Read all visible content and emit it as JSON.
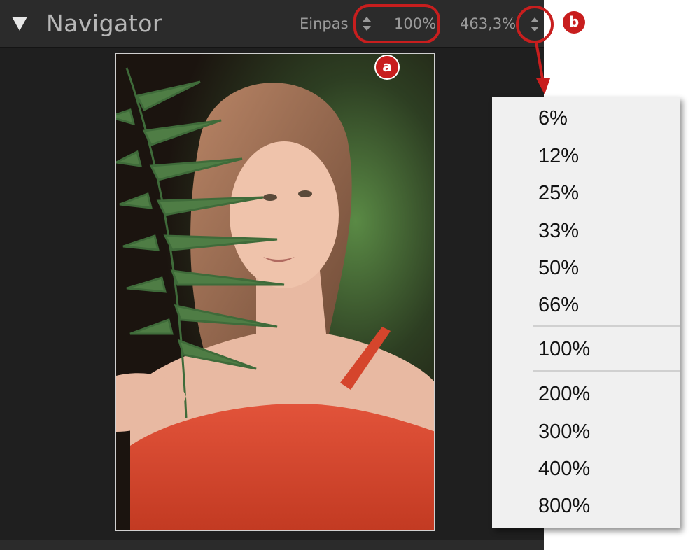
{
  "navigator": {
    "title": "Navigator",
    "fit_label": "Einpas",
    "zoom_value": "100%",
    "custom_zoom": "463,3%"
  },
  "annotations": {
    "badge_a": "a",
    "badge_b": "b"
  },
  "zoom_menu": {
    "items": [
      "6%",
      "12%",
      "25%",
      "33%",
      "50%",
      "66%",
      "100%",
      "200%",
      "300%",
      "400%",
      "800%"
    ]
  },
  "colors": {
    "annotation_red": "#c81e1e",
    "panel_bg": "#1f1f1f",
    "menu_bg": "#f0f0f0"
  }
}
